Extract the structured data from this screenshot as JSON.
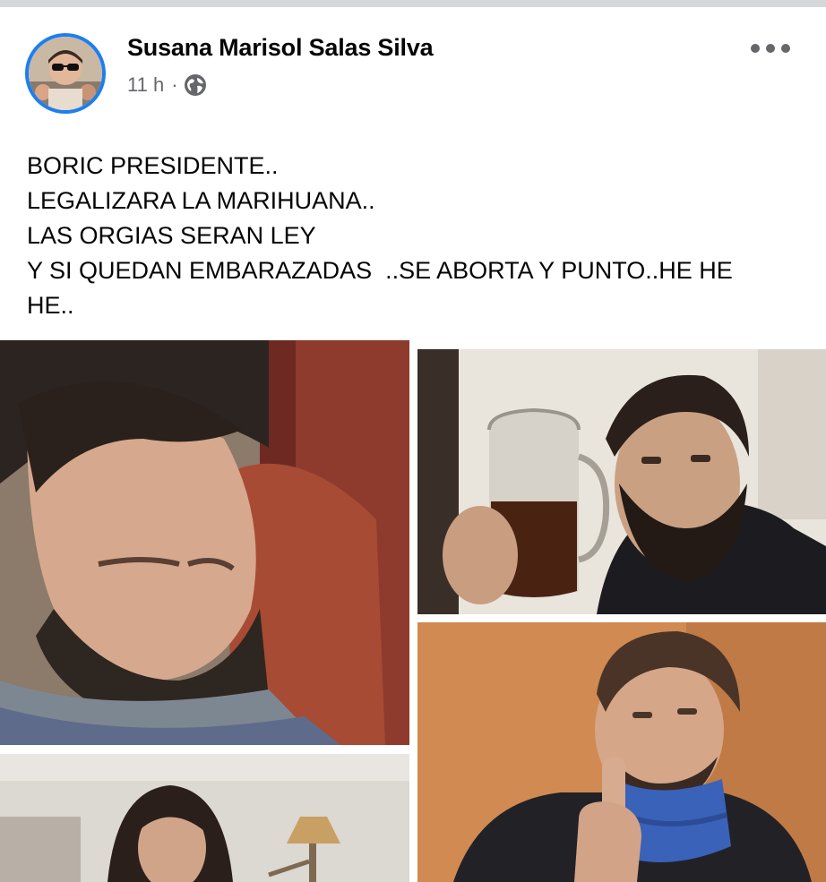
{
  "post": {
    "author": "Susana Marisol Salas Silva",
    "time": "11 h",
    "separator": "·",
    "audience_icon": "globe-icon",
    "more_icon": "more-options-icon",
    "text_lines": [
      "BORIC PRESIDENTE..",
      "LEGALIZARA LA MARIHUANA..",
      "LAS ORGIAS SERAN LEY",
      "Y SI QUEDAN EMBARAZADAS  ..SE ABORTA Y PUNTO..HE HE",
      "HE.."
    ]
  },
  "photos": [
    {
      "name": "photo-man-sleeping"
    },
    {
      "name": "photo-man-with-mug"
    },
    {
      "name": "photo-man-long-hair"
    },
    {
      "name": "photo-man-gesture"
    }
  ],
  "colors": {
    "accent": "#1d7ef0",
    "text": "#050505",
    "secondary": "#65676b",
    "topbar": "#d6d7da"
  }
}
